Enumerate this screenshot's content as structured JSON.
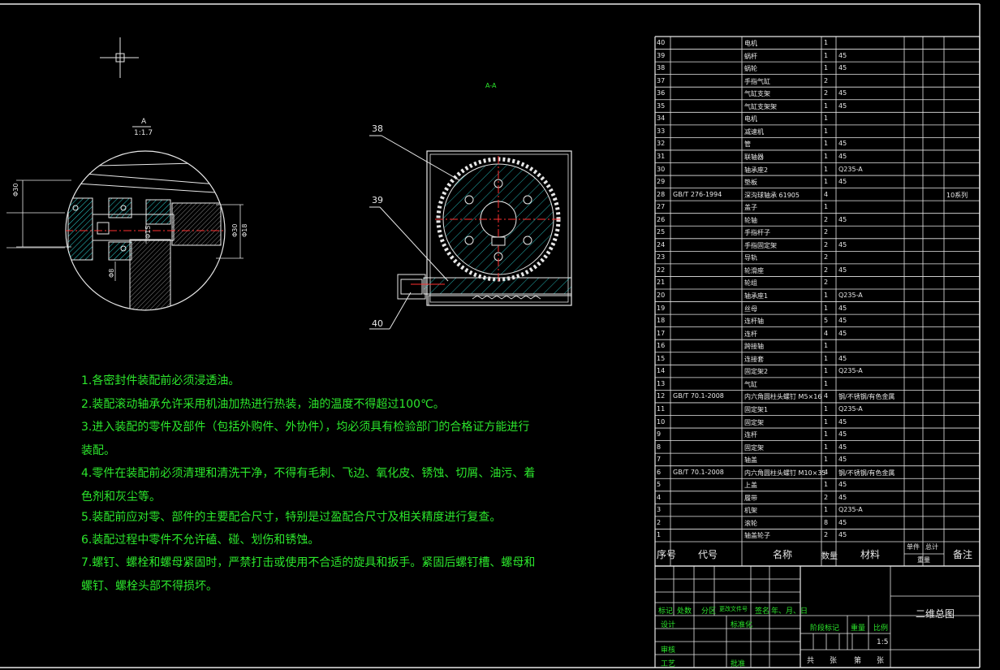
{
  "colors": {
    "line": "#e8e8e8",
    "hatch": "#2ad2d2",
    "center": "#ff3030",
    "text_green": "#2ce62c"
  },
  "detail": {
    "label_top": "A",
    "label_scale": "1:1.7",
    "dims": [
      "Φ30",
      "Φ15",
      "Φ30",
      "Φ8",
      "Φ18"
    ]
  },
  "section": {
    "label": "A-A",
    "callouts": [
      "38",
      "39",
      "40"
    ]
  },
  "notes": [
    "1.各密封件装配前必须浸透油。",
    "2.装配滚动轴承允许采用机油加热进行热装，油的温度不得超过100℃。",
    "3.进入装配的零件及部件（包括外购件、外协件），均必须具有检验部门的合格证方能进行装配。",
    "4.零件在装配前必须清理和清洗干净，不得有毛刺、飞边、氧化皮、锈蚀、切屑、油污、着色剂和灰尘等。",
    "5.装配前应对零、部件的主要配合尺寸，特别是过盈配合尺寸及相关精度进行复查。",
    "6.装配过程中零件不允许磕、碰、划伤和锈蚀。",
    "7.螺钉、螺栓和螺母紧固时，严禁打击或使用不合适的旋具和扳手。紧固后螺钉槽、螺母和螺钉、螺栓头部不得损坏。"
  ],
  "bom": {
    "rows": [
      {
        "no": "40",
        "code": "",
        "name": "电机",
        "qty": "1",
        "mat": "",
        "note": ""
      },
      {
        "no": "39",
        "code": "",
        "name": "蜗杆",
        "qty": "1",
        "mat": "45",
        "note": ""
      },
      {
        "no": "38",
        "code": "",
        "name": "蜗轮",
        "qty": "1",
        "mat": "45",
        "note": ""
      },
      {
        "no": "37",
        "code": "",
        "name": "手指气缸",
        "qty": "2",
        "mat": "",
        "note": ""
      },
      {
        "no": "36",
        "code": "",
        "name": "气缸支架",
        "qty": "2",
        "mat": "45",
        "note": ""
      },
      {
        "no": "35",
        "code": "",
        "name": "气缸支架架",
        "qty": "1",
        "mat": "45",
        "note": ""
      },
      {
        "no": "34",
        "code": "",
        "name": "电机",
        "qty": "1",
        "mat": "",
        "note": ""
      },
      {
        "no": "33",
        "code": "",
        "name": "减速机",
        "qty": "1",
        "mat": "",
        "note": ""
      },
      {
        "no": "32",
        "code": "",
        "name": "管",
        "qty": "1",
        "mat": "45",
        "note": ""
      },
      {
        "no": "31",
        "code": "",
        "name": "联轴器",
        "qty": "1",
        "mat": "45",
        "note": ""
      },
      {
        "no": "30",
        "code": "",
        "name": "轴承座2",
        "qty": "1",
        "mat": "Q235-A",
        "note": ""
      },
      {
        "no": "29",
        "code": "",
        "name": "垫板",
        "qty": "1",
        "mat": "45",
        "note": ""
      },
      {
        "no": "28",
        "code": "GB/T 276-1994",
        "name": "深沟球轴承 61905",
        "qty": "4",
        "mat": "",
        "note": "10系列"
      },
      {
        "no": "27",
        "code": "",
        "name": "盖子",
        "qty": "1",
        "mat": "",
        "note": ""
      },
      {
        "no": "26",
        "code": "",
        "name": "轮轴",
        "qty": "2",
        "mat": "45",
        "note": ""
      },
      {
        "no": "25",
        "code": "",
        "name": "手指杆子",
        "qty": "2",
        "mat": "",
        "note": ""
      },
      {
        "no": "24",
        "code": "",
        "name": "手指固定架",
        "qty": "2",
        "mat": "45",
        "note": ""
      },
      {
        "no": "23",
        "code": "",
        "name": "导轨",
        "qty": "2",
        "mat": "",
        "note": ""
      },
      {
        "no": "22",
        "code": "",
        "name": "轮滑座",
        "qty": "2",
        "mat": "45",
        "note": ""
      },
      {
        "no": "21",
        "code": "",
        "name": "轮组",
        "qty": "2",
        "mat": "",
        "note": ""
      },
      {
        "no": "20",
        "code": "",
        "name": "轴承座1",
        "qty": "1",
        "mat": "Q235-A",
        "note": ""
      },
      {
        "no": "19",
        "code": "",
        "name": "丝母",
        "qty": "1",
        "mat": "45",
        "note": ""
      },
      {
        "no": "18",
        "code": "",
        "name": "连杆轴",
        "qty": "5",
        "mat": "45",
        "note": ""
      },
      {
        "no": "17",
        "code": "",
        "name": "连杆",
        "qty": "4",
        "mat": "45",
        "note": ""
      },
      {
        "no": "16",
        "code": "",
        "name": "跨接轴",
        "qty": "1",
        "mat": "",
        "note": ""
      },
      {
        "no": "15",
        "code": "",
        "name": "连接套",
        "qty": "1",
        "mat": "45",
        "note": ""
      },
      {
        "no": "14",
        "code": "",
        "name": "固定架2",
        "qty": "1",
        "mat": "Q235-A",
        "note": ""
      },
      {
        "no": "13",
        "code": "",
        "name": "气缸",
        "qty": "1",
        "mat": "",
        "note": ""
      },
      {
        "no": "12",
        "code": "GB/T 70.1-2008",
        "name": "内六角圆柱头螺钉 M5×16",
        "qty": "4",
        "mat": "钢/不锈钢/有色金属",
        "note": ""
      },
      {
        "no": "11",
        "code": "",
        "name": "固定架1",
        "qty": "1",
        "mat": "Q235-A",
        "note": ""
      },
      {
        "no": "10",
        "code": "",
        "name": "固定架",
        "qty": "1",
        "mat": "45",
        "note": ""
      },
      {
        "no": "9",
        "code": "",
        "name": "连杆",
        "qty": "1",
        "mat": "45",
        "note": ""
      },
      {
        "no": "8",
        "code": "",
        "name": "固定架",
        "qty": "1",
        "mat": "45",
        "note": ""
      },
      {
        "no": "7",
        "code": "",
        "name": "轴盖",
        "qty": "1",
        "mat": "45",
        "note": ""
      },
      {
        "no": "6",
        "code": "GB/T 70.1-2008",
        "name": "内六角圆柱头螺钉 M10×35",
        "qty": "4",
        "mat": "钢/不锈钢/有色金属",
        "note": ""
      },
      {
        "no": "5",
        "code": "",
        "name": "上盖",
        "qty": "1",
        "mat": "45",
        "note": ""
      },
      {
        "no": "4",
        "code": "",
        "name": "履带",
        "qty": "2",
        "mat": "45",
        "note": ""
      },
      {
        "no": "3",
        "code": "",
        "name": "机架",
        "qty": "1",
        "mat": "Q235-A",
        "note": ""
      },
      {
        "no": "2",
        "code": "",
        "name": "滚轮",
        "qty": "8",
        "mat": "45",
        "note": ""
      },
      {
        "no": "1",
        "code": "",
        "name": "轴盖轮子",
        "qty": "2",
        "mat": "45",
        "note": ""
      }
    ],
    "header": {
      "no": "序号",
      "code": "代号",
      "name": "名称",
      "qty": "数量",
      "mat": "材料",
      "unit": "单件",
      "total": "总计",
      "weight": "重量",
      "note": "备注"
    }
  },
  "titleblock": {
    "mark": "标记",
    "count": "处数",
    "zone": "分区",
    "doc": "更改文件号",
    "sign": "签名",
    "date": "年、月、日",
    "design": "设计",
    "std": "标准化",
    "check": "审核",
    "process": "工艺",
    "approve": "批准",
    "stage": "阶段标记",
    "weight": "重量",
    "scale": "比例",
    "scale_val": "1:5",
    "total": "共",
    "sheets": "张",
    "page": "第",
    "sheet": "张",
    "title": "二维总图"
  }
}
